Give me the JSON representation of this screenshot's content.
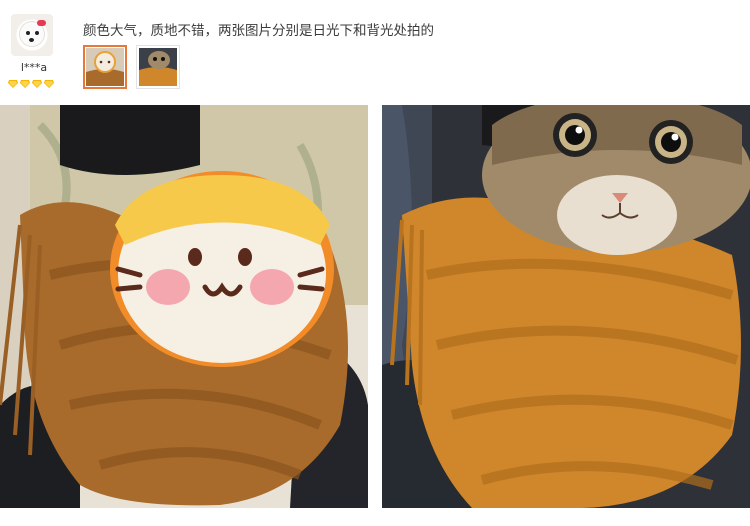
{
  "review": {
    "username": "l***a",
    "badge_count": 4,
    "badge_icon": "diamond-icon",
    "badge_color": "#f5b400",
    "comment": "颜色大气，质地不错，两张图片分别是日光下和背光处拍的",
    "selected_thumbnail": 0,
    "accent_color": "#e8783a"
  },
  "photos": [
    {
      "icon": "cartoon-cat-sticker-icon",
      "scarf_color": "#a86b2b"
    },
    {
      "icon": "cat-face-sticker-icon",
      "scarf_color": "#d0862a"
    }
  ]
}
